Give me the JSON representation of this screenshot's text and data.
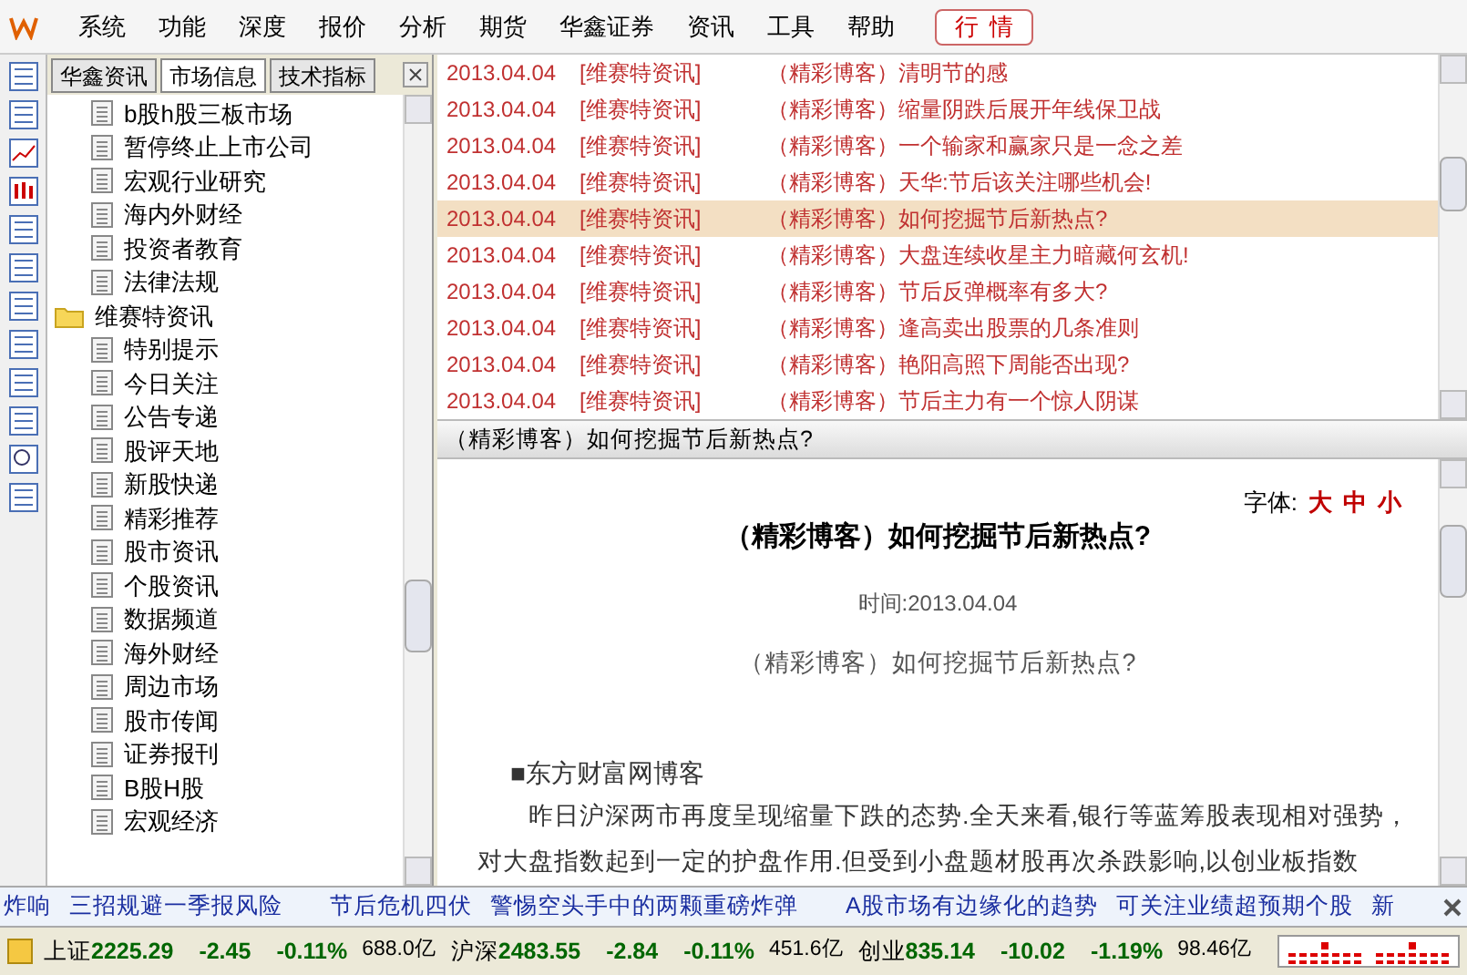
{
  "menu_bar": {
    "items": [
      "系统",
      "功能",
      "深度",
      "报价",
      "分析",
      "期货",
      "华鑫证券",
      "资讯",
      "工具",
      "帮助"
    ],
    "quote_button": "行情"
  },
  "side_tabs": [
    {
      "label": "华鑫资讯",
      "selected": false
    },
    {
      "label": "市场信息",
      "selected": true
    },
    {
      "label": "技术指标",
      "selected": false
    }
  ],
  "tree": [
    {
      "children": [
        {
          "label": "b股h股三板市场"
        },
        {
          "label": "暂停终止上市公司"
        },
        {
          "label": "宏观行业研究"
        },
        {
          "label": "海内外财经"
        },
        {
          "label": "投资者教育"
        },
        {
          "label": "法律法规"
        }
      ]
    },
    {
      "label": "维赛特资讯",
      "children": [
        {
          "label": "特别提示"
        },
        {
          "label": "今日关注"
        },
        {
          "label": "公告专递"
        },
        {
          "label": "股评天地"
        },
        {
          "label": "新股快递"
        },
        {
          "label": "精彩推荐"
        },
        {
          "label": "股市资讯"
        },
        {
          "label": "个股资讯"
        },
        {
          "label": "数据频道"
        },
        {
          "label": "海外财经"
        },
        {
          "label": "周边市场"
        },
        {
          "label": "股市传闻"
        },
        {
          "label": "证券报刊"
        },
        {
          "label": "B股H股"
        },
        {
          "label": "宏观经济"
        }
      ]
    }
  ],
  "news_list": [
    {
      "date": "2013.04.04",
      "source": "[维赛特资讯]",
      "title": "（精彩博客）清明节的感",
      "selected": false
    },
    {
      "date": "2013.04.04",
      "source": "[维赛特资讯]",
      "title": "（精彩博客）缩量阴跌后展开年线保卫战",
      "selected": false
    },
    {
      "date": "2013.04.04",
      "source": "[维赛特资讯]",
      "title": "（精彩博客）一个输家和赢家只是一念之差",
      "selected": false
    },
    {
      "date": "2013.04.04",
      "source": "[维赛特资讯]",
      "title": "（精彩博客）天华:节后该关注哪些机会!",
      "selected": false
    },
    {
      "date": "2013.04.04",
      "source": "[维赛特资讯]",
      "title": "（精彩博客）如何挖掘节后新热点?",
      "selected": true
    },
    {
      "date": "2013.04.04",
      "source": "[维赛特资讯]",
      "title": "（精彩博客）大盘连续收星主力暗藏何玄机!",
      "selected": false
    },
    {
      "date": "2013.04.04",
      "source": "[维赛特资讯]",
      "title": "（精彩博客）节后反弹概率有多大?",
      "selected": false
    },
    {
      "date": "2013.04.04",
      "source": "[维赛特资讯]",
      "title": "（精彩博客）逢高卖出股票的几条准则",
      "selected": false
    },
    {
      "date": "2013.04.04",
      "source": "[维赛特资讯]",
      "title": "（精彩博客）艳阳高照下周能否出现?",
      "selected": false
    },
    {
      "date": "2013.04.04",
      "source": "[维赛特资讯]",
      "title": "（精彩博客）节后主力有一个惊人阴谋",
      "selected": false
    }
  ],
  "preview": {
    "header": "（精彩博客）如何挖掘节后新热点?",
    "font_label": "字体:",
    "font_sizes": [
      "大",
      "中",
      "小"
    ],
    "title": "（精彩博客）如何挖掘节后新热点?",
    "time": "时间:2013.04.04",
    "subtitle": "（精彩博客）如何挖掘节后新热点?",
    "section": "■东方财富网博客",
    "paragraph": "昨日沪深两市再度呈现缩量下跌的态势.全天来看,银行等蓝筹股表现相对强势，对大盘指数起到一定的护盘作用.但受到小盘题材股再次杀跌影响,以创业板指数"
  },
  "ticker": [
    "炸响",
    "三招规避一季报风险",
    "节后危机四伏",
    "警惕空头手中的两颗重磅炸弹",
    "A股市场有边缘化的趋势",
    "可关注业绩超预期个股",
    "新"
  ],
  "status_bar": [
    {
      "name": "上证",
      "value": "2225.29",
      "change": "-2.45",
      "pct": "-0.11%",
      "volume": "688.0亿"
    },
    {
      "name": "沪深",
      "value": "2483.55",
      "change": "-2.84",
      "pct": "-0.11%",
      "volume": "451.6亿"
    },
    {
      "name": "创业",
      "value": "835.14",
      "change": "-10.02",
      "pct": "-1.19%",
      "volume": "98.46亿"
    }
  ]
}
